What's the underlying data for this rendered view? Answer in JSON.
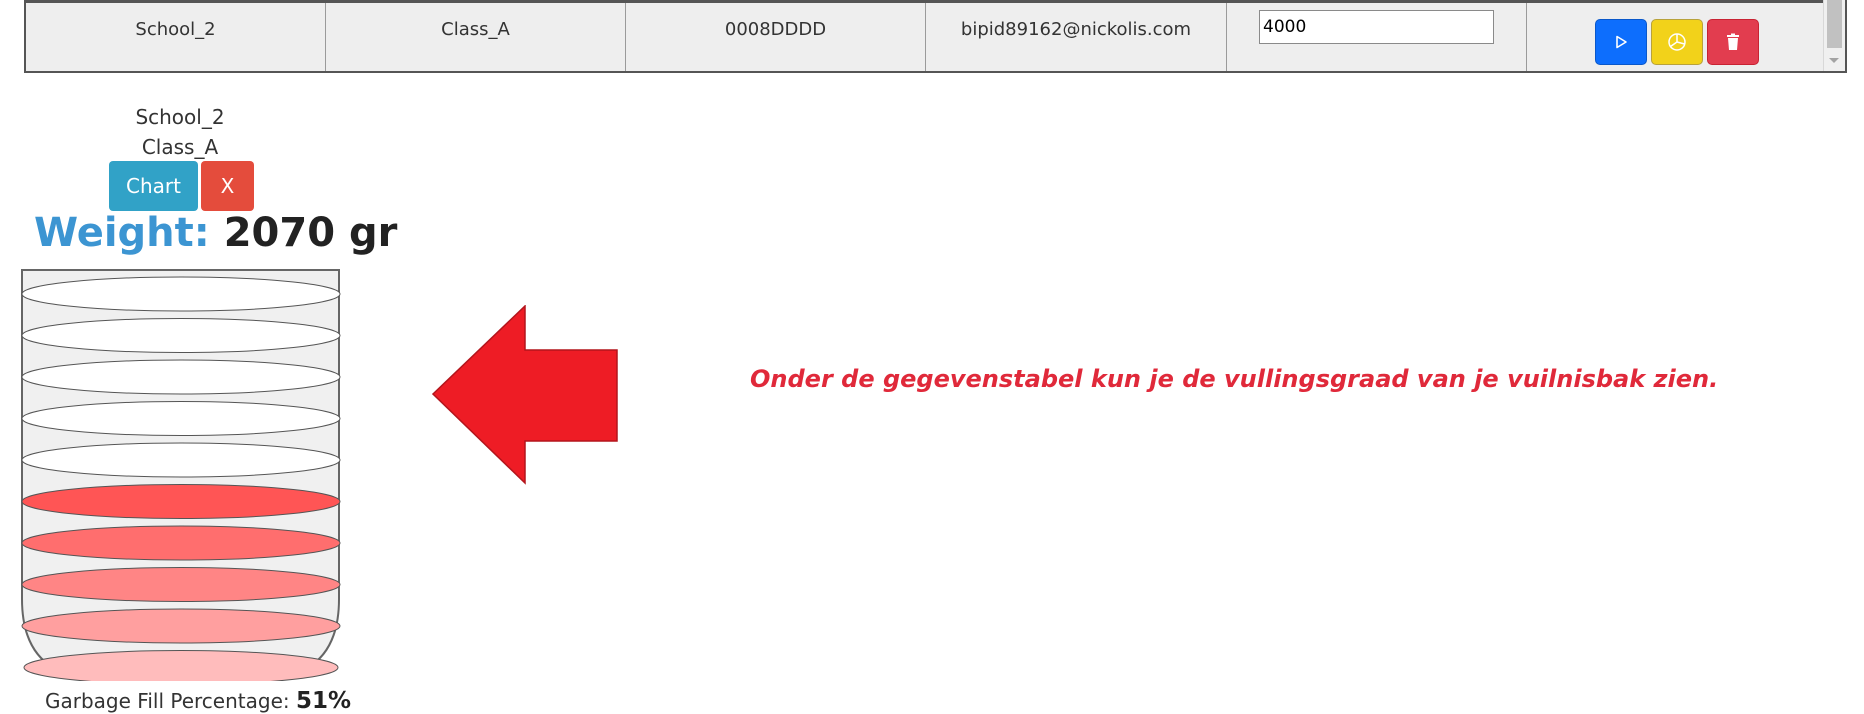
{
  "table": {
    "row": {
      "school": "School_2",
      "class": "Class_A",
      "id": "0008DDDD",
      "email": "bipid89162@nickolis.com",
      "capacity": "4000"
    },
    "actions": [
      {
        "name": "play-button",
        "icon": "play-icon",
        "color": "#0d6efd"
      },
      {
        "name": "chart-button",
        "icon": "pie-chart-icon",
        "color": "#f2d21a"
      },
      {
        "name": "delete-button",
        "icon": "trash-icon",
        "color": "#e23d4f"
      }
    ]
  },
  "panel": {
    "school": "School_2",
    "class": "Class_A",
    "chart_button": "Chart",
    "close_button": "X",
    "weight_label": "Weight:",
    "weight_value": "2070 gr",
    "fill_label": "Garbage Fill Percentage:",
    "fill_value": "51%",
    "fill_percent": 51
  },
  "hint": {
    "text": "Onder de gegevenstabel kun je de vullingsgraad van je vuilnisbak zien.",
    "color": "#e0293a"
  },
  "colors": {
    "arrow": "#ee1c25",
    "fill_layers": [
      "#ffbcbc",
      "#ff9f9f",
      "#ff8585",
      "#ff6e6e",
      "#ff5555"
    ]
  }
}
